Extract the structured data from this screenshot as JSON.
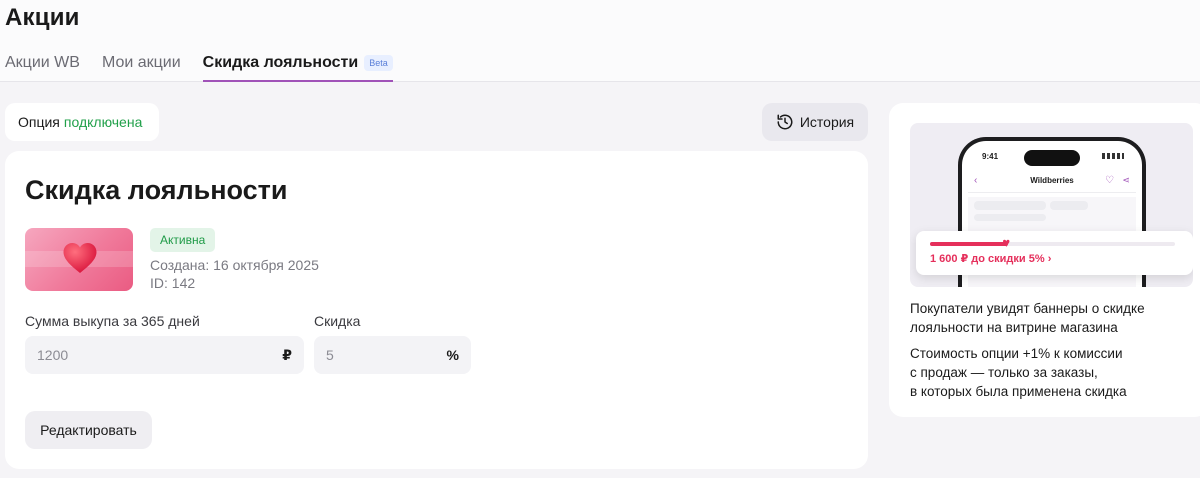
{
  "page": {
    "title": "Акции"
  },
  "tabs": [
    {
      "label": "Акции WB"
    },
    {
      "label": "Мои акции"
    },
    {
      "label": "Скидка лояльности",
      "badge": "Beta"
    }
  ],
  "option_status": {
    "prefix": "Опция",
    "value": "подключена"
  },
  "history_button": {
    "label": "История"
  },
  "promo": {
    "title": "Скидка лояльности",
    "status": "Активна",
    "created": "Создана: 16 октября 2025",
    "id": "ID: 142",
    "purchase_sum": {
      "label": "Сумма выкупа за 365 дней",
      "value": "1200",
      "unit": "₽"
    },
    "discount": {
      "label": "Скидка",
      "value": "5",
      "unit": "%"
    },
    "edit_label": "Редактировать"
  },
  "info": {
    "phone": {
      "time": "9:41",
      "app_title": "Wildberries",
      "banner_text": "1 600 ₽ до скидки 5% ›",
      "progress": 0.32
    },
    "text1": "Покупатели увидят баннеры о скидке лояльности на витрине магазина",
    "text2_line1": "Стоимость опции +1% к комиссии",
    "text2_line2": "с продаж — только за заказы,",
    "text2_line3": "в которых была применена скидка"
  },
  "colors": {
    "accent": "#a052b8",
    "success": "#21a04a",
    "banner_red": "#e52f5b"
  },
  "icons": [
    "history-icon",
    "heart-icon",
    "back-chevron-icon",
    "favorite-icon",
    "share-icon"
  ]
}
